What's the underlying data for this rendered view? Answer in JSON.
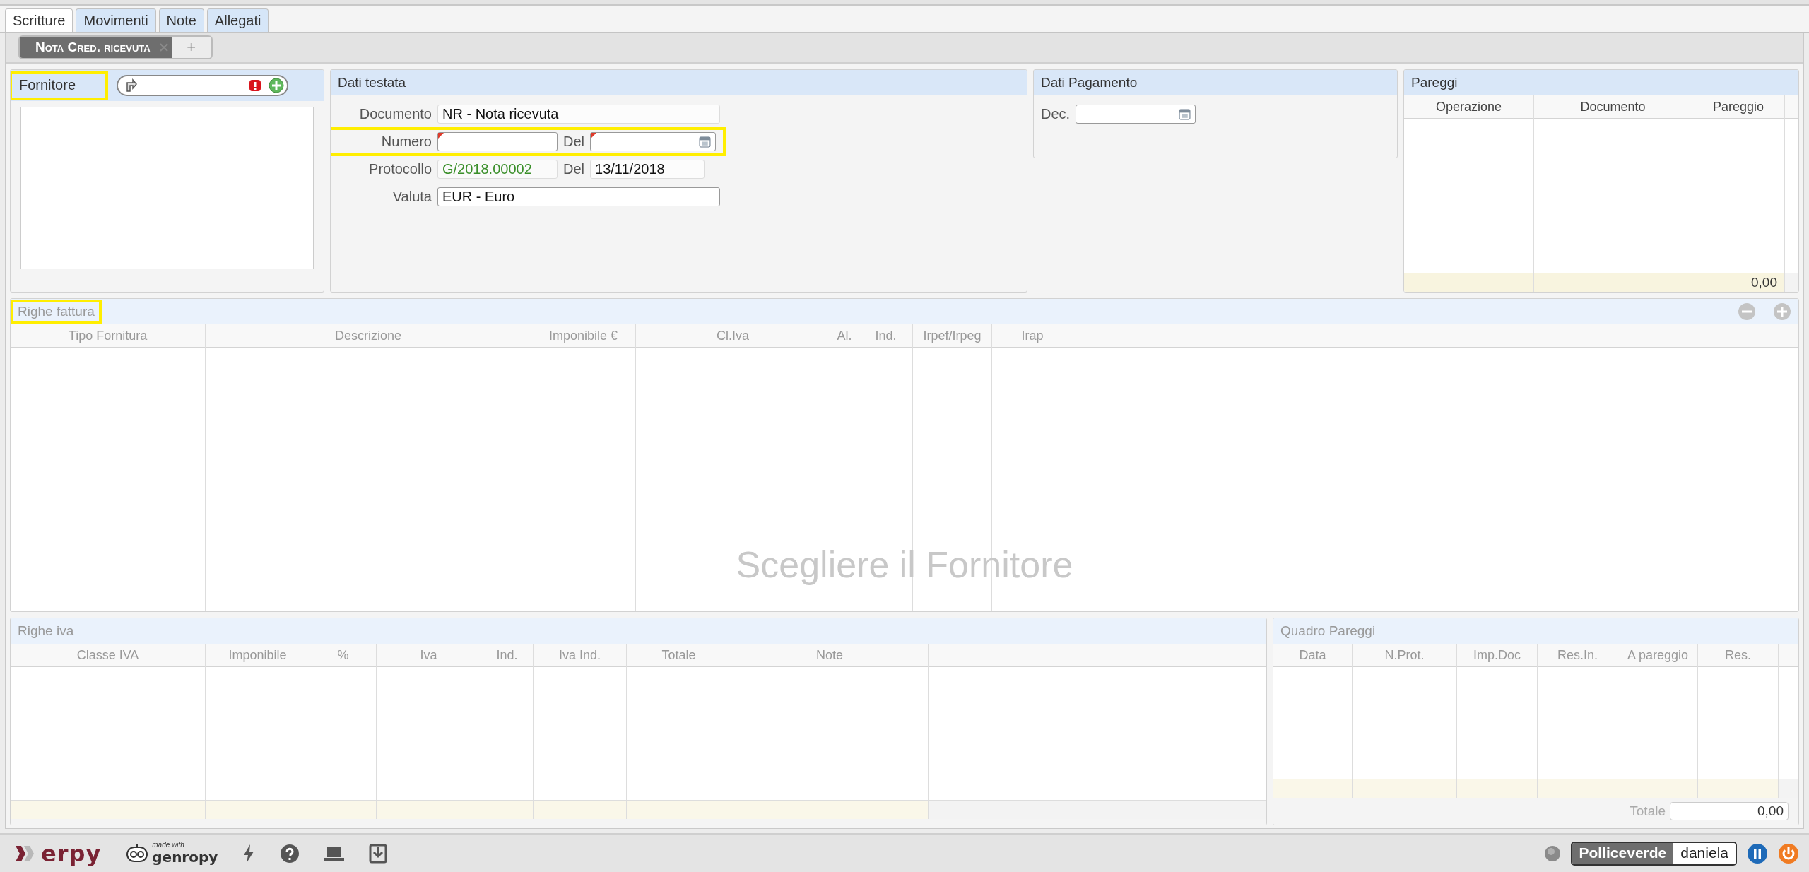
{
  "tabs": [
    {
      "label": "Scritture",
      "selected": true
    },
    {
      "label": "Movimenti",
      "selected": false
    },
    {
      "label": "Note",
      "selected": false
    },
    {
      "label": "Allegati",
      "selected": false
    }
  ],
  "doc_tabs": [
    {
      "label": "Nota Cred. ricevuta",
      "selected": true
    }
  ],
  "add_tab": "+",
  "fornitore": {
    "label": "Fornitore",
    "highlighted": true
  },
  "dati_testata": {
    "title": "Dati testata",
    "rows": [
      {
        "highlighted": false,
        "fields": [
          {
            "label": "Documento",
            "value": "NR - Nota ricevuta",
            "kind": "readonly",
            "required": false
          }
        ]
      },
      {
        "highlighted": true,
        "fields": [
          {
            "label": "Numero",
            "kind": "text",
            "required": true
          },
          {
            "label": "Del",
            "kind": "date",
            "required": true
          }
        ]
      },
      {
        "highlighted": false,
        "fields": [
          {
            "label": "Protocollo",
            "value": "G/2018.00002",
            "kind": "protocol",
            "required": false
          },
          {
            "label": "Del",
            "value": "13/11/2018",
            "kind": "readonly",
            "required": false
          }
        ]
      },
      {
        "highlighted": false,
        "fields": [
          {
            "label": "Valuta",
            "value": "EUR - Euro",
            "kind": "text",
            "required": false
          }
        ]
      }
    ]
  },
  "dati_pagamento": {
    "title": "Dati Pagamento",
    "fields": [
      {
        "label": "Dec.",
        "kind": "date",
        "required": false
      }
    ]
  },
  "pareggi": {
    "title": "Pareggi",
    "columns": [
      "Operazione",
      "Documento",
      "Pareggio"
    ],
    "total": "0,00"
  },
  "righe_fattura": {
    "title": "Righe fattura",
    "disabled": true,
    "highlighted": true,
    "columns": [
      "Tipo Fornitura",
      "Descrizione",
      "Imponibile €",
      "Cl.Iva",
      "Al.",
      "Ind.",
      "Irpef/Irpeg",
      "Irap"
    ],
    "empty_message": "Scegliere il Fornitore"
  },
  "righe_iva": {
    "title": "Righe iva",
    "disabled": true,
    "columns": [
      "Classe IVA",
      "Imponibile",
      "%",
      "Iva",
      "Ind.",
      "Iva Ind.",
      "Totale",
      "Note"
    ]
  },
  "quadro_pareggi": {
    "title": "Quadro Pareggi",
    "disabled": true,
    "columns": [
      "Data",
      "N.Prot.",
      "Imp.Doc",
      "Res.In.",
      "A pareggio",
      "Res."
    ],
    "total_label": "Totale",
    "total": "0,00"
  },
  "status_bar": {
    "brand": "erpy",
    "made_with": "made with",
    "framework": "genropy",
    "company": "Polliceverde",
    "user": "daniela"
  }
}
